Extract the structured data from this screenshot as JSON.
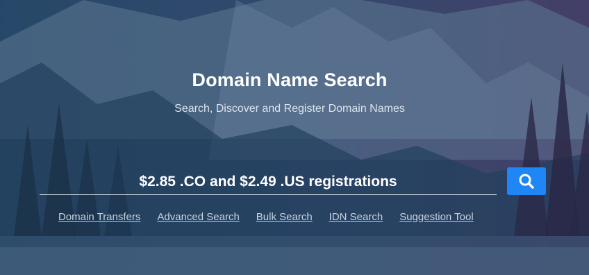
{
  "hero": {
    "title": "Domain Name Search",
    "subtitle": "Search, Discover and Register Domain Names"
  },
  "search": {
    "placeholder": "$2.85 .CO and $2.49 .US registrations",
    "value": "",
    "button_icon": "search-icon",
    "button_color": "#1f86f5"
  },
  "links": [
    {
      "label": "Domain Transfers"
    },
    {
      "label": "Advanced Search"
    },
    {
      "label": "Bulk Search"
    },
    {
      "label": "IDN Search"
    },
    {
      "label": "Suggestion Tool"
    }
  ],
  "colors": {
    "overlay_left": "#264868",
    "overlay_right": "#463e68",
    "text": "#ffffff",
    "link": "#c8d3e0"
  }
}
